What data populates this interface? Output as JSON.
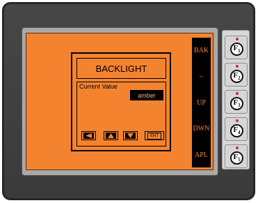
{
  "dialog": {
    "title": "BACKLIGHT",
    "field_label": "Current Value",
    "field_value": "amber"
  },
  "softkeys": [
    {
      "label": "BAK"
    },
    {
      "label": "–"
    },
    {
      "label": "UP"
    },
    {
      "label": "DWN"
    },
    {
      "label": "APL"
    }
  ],
  "nav_buttons": [
    {
      "icon": "left-arrow-icon"
    },
    {
      "icon": "up-arrow-icon"
    },
    {
      "icon": "down-arrow-icon"
    }
  ],
  "enter_label": "ENT",
  "function_keys": [
    {
      "letter": "F",
      "num": "1"
    },
    {
      "letter": "F",
      "num": "2"
    },
    {
      "letter": "F",
      "num": "3"
    },
    {
      "letter": "F",
      "num": "4"
    },
    {
      "letter": "F",
      "num": "5"
    }
  ],
  "colors": {
    "screen": "#f48330",
    "device_body": "#404040",
    "led": "#c4302b"
  }
}
